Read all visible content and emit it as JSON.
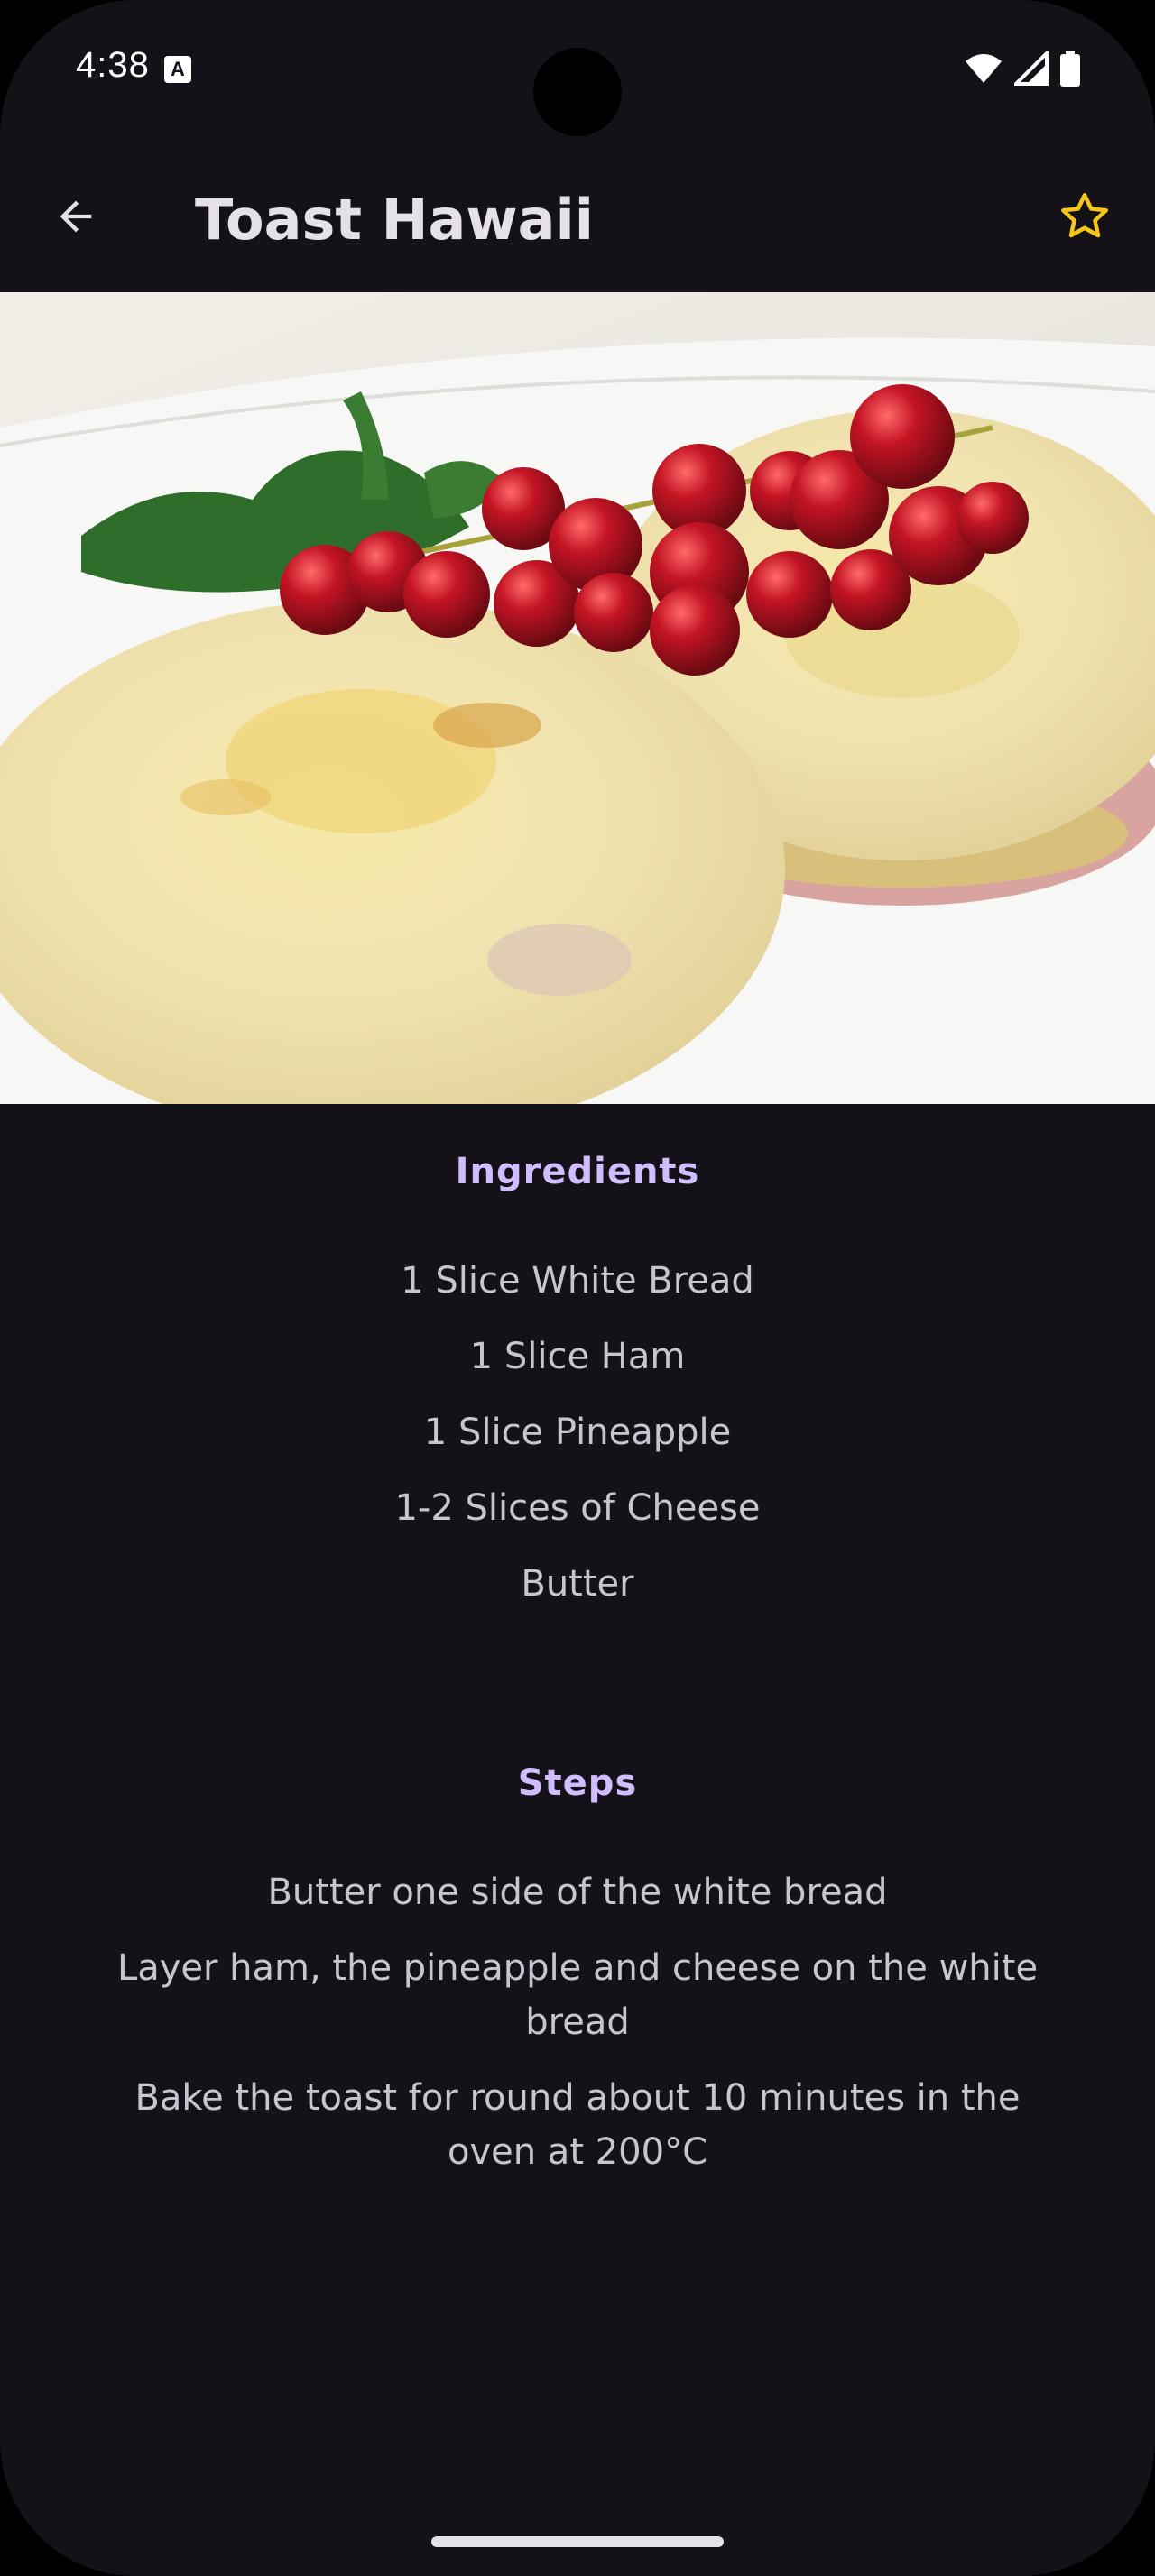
{
  "status_bar": {
    "time": "4:38",
    "notification_icon": "accessibility-a-icon",
    "icons": [
      "wifi-icon",
      "cellular-signal-icon",
      "battery-icon"
    ]
  },
  "app_bar": {
    "back_icon": "arrow-back-icon",
    "title": "Toast Hawaii",
    "favorite_icon": "star-outline-icon",
    "favorite_color": "#f5c518"
  },
  "hero_image": {
    "subject": "toast-hawaii-photo"
  },
  "ingredients": {
    "title": "Ingredients",
    "items": [
      "1 Slice White Bread",
      "1 Slice Ham",
      "1 Slice Pineapple",
      "1-2 Slices of Cheese",
      "Butter"
    ]
  },
  "steps": {
    "title": "Steps",
    "items": [
      "Butter one side of the white bread",
      "Layer ham, the pineapple and cheese on the white bread",
      "Bake the toast for round about 10 minutes in the oven at 200°C"
    ]
  },
  "colors": {
    "background": "#141218",
    "accent": "#d0bcff",
    "text": "#cac4d0",
    "title": "#e6e0e9"
  }
}
